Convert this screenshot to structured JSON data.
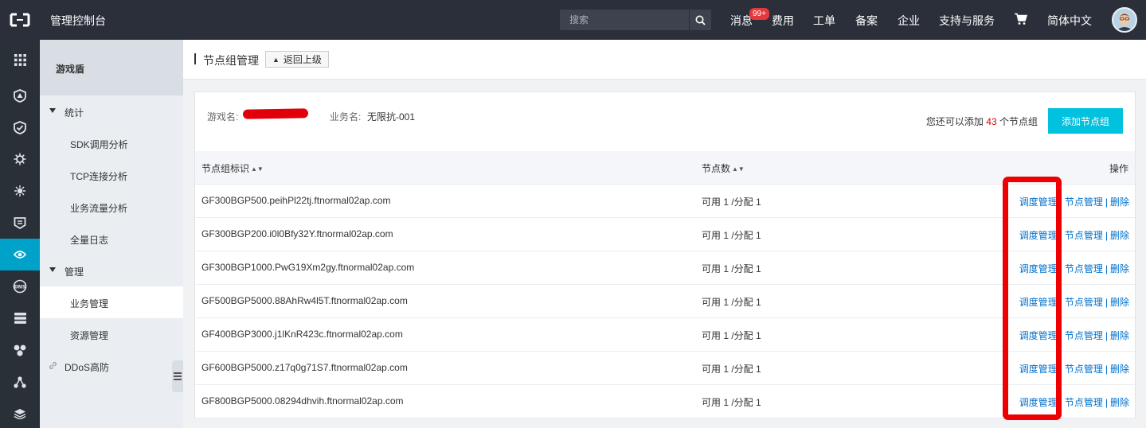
{
  "topbar": {
    "console_title": "管理控制台",
    "search_placeholder": "搜索",
    "nav": {
      "messages": "消息",
      "messages_badge": "99+",
      "fees": "费用",
      "tickets": "工单",
      "filing": "备案",
      "enterprise": "企业",
      "support": "支持与服务",
      "language": "简体中文"
    }
  },
  "sidebar": {
    "product": "游戏盾",
    "groups": [
      {
        "label": "统计",
        "items": [
          "SDK调用分析",
          "TCP连接分析",
          "业务流量分析",
          "全量日志"
        ]
      },
      {
        "label": "管理",
        "items": [
          "业务管理",
          "资源管理"
        ]
      }
    ],
    "link_item": "DDoS高防"
  },
  "page": {
    "title": "节点组管理",
    "back_label": "返回上级"
  },
  "info": {
    "game_label": "游戏名:",
    "business_label": "业务名:",
    "business_value": "无限抗-001",
    "quota_prefix": "您还可以添加",
    "quota_count": "43",
    "quota_suffix": "个节点组",
    "add_button": "添加节点组"
  },
  "table": {
    "headers": {
      "id": "节点组标识",
      "count": "节点数",
      "ops": "操作"
    },
    "ops_labels": {
      "schedule": "调度管理",
      "nodes": "节点管理",
      "delete": "删除",
      "sep": "|"
    },
    "rows": [
      {
        "id": "GF300BGP500.peihPl22tj.ftnormal02ap.com",
        "count": "可用 1 /分配 1"
      },
      {
        "id": "GF300BGP200.i0l0Bfy32Y.ftnormal02ap.com",
        "count": "可用 1 /分配 1"
      },
      {
        "id": "GF300BGP1000.PwG19Xm2gy.ftnormal02ap.com",
        "count": "可用 1 /分配 1"
      },
      {
        "id": "GF500BGP5000.88AhRw4l5T.ftnormal02ap.com",
        "count": "可用 1 /分配 1"
      },
      {
        "id": "GF400BGP3000.j1lKnR423c.ftnormal02ap.com",
        "count": "可用 1 /分配 1"
      },
      {
        "id": "GF600BGP5000.z17q0g71S7.ftnormal02ap.com",
        "count": "可用 1 /分配 1"
      },
      {
        "id": "GF800BGP5000.08294dhvih.ftnormal02ap.com",
        "count": "可用 1 /分配 1"
      }
    ]
  },
  "colors": {
    "topbar_bg": "#2a2f3a",
    "accent": "#00c1de",
    "rail_active": "#00a2ca",
    "link": "#0070cc",
    "highlight": "#ee0000"
  }
}
